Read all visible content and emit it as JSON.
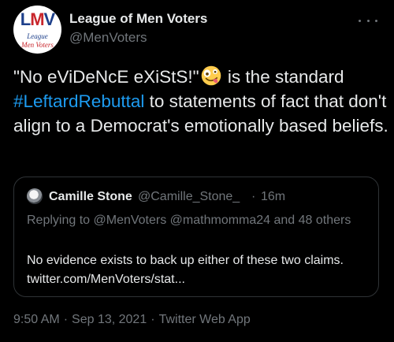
{
  "author": {
    "display_name": "League of Men Voters",
    "handle": "@MenVoters",
    "avatar": {
      "logo_text_l": "L",
      "logo_text_m": "M",
      "logo_text_v": "V",
      "line1": "League",
      "line2": "Men Voters"
    }
  },
  "tweet": {
    "text_before_emoji": "\"No eViDeNcE eXiStS!\"",
    "emoji": "zany-face-icon",
    "text_after_emoji": " is the standard ",
    "hashtag": "#LeftardRebuttal",
    "text_after_hashtag": " to statements of fact that don't align to a Democrat's emotionally based beliefs."
  },
  "quoted_tweet": {
    "display_name": "Camille Stone",
    "handle": "@Camille_Stone_",
    "dot": "·",
    "time": "16m",
    "replying_prefix": "Replying to ",
    "replying_mentions": "@MenVoters @mathmomma24",
    "replying_suffix": " and 48 others",
    "body_line1": "No evidence exists to back up either of these two claims.",
    "body_line2": "twitter.com/MenVoters/stat..."
  },
  "meta": {
    "time": "9:50 AM",
    "date": "Sep 13, 2021",
    "source": "Twitter Web App",
    "sep": "·"
  },
  "colors": {
    "background": "#000000",
    "text": "#e7e9ea",
    "secondary": "#71767b",
    "accent": "#1d9bf0",
    "border": "#2f3336"
  }
}
